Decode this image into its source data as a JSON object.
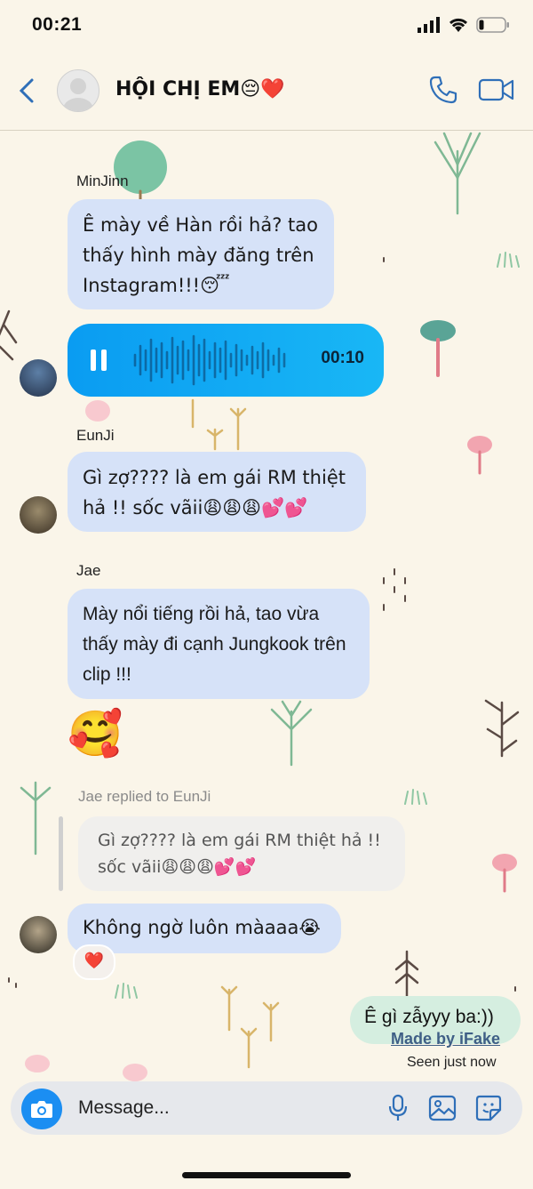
{
  "status_bar": {
    "time": "00:21"
  },
  "header": {
    "title": "HỘI CHỊ EM😔❤️"
  },
  "messages": [
    {
      "sender": "MinJinn",
      "text": "Ê mày về Hàn rồi hả? tao thấy hình mày đăng trên Instagram!!!😴"
    },
    {
      "voice_duration": "00:10"
    },
    {
      "sender": "EunJi",
      "text": "Gì zợ???? là em gái RM thiệt hả !! sốc vãii😩😩😩💕💕"
    },
    {
      "sender": "Jae",
      "text": "Mày nổi tiếng rồi hả, tao vừa thấy mày đi cạnh Jungkook trên clip !!!"
    },
    {
      "emoji": "🥰"
    },
    {
      "reply_label": "Jae replied to EunJi",
      "quoted": "Gì zợ???? là em gái RM thiệt hả !! sốc vãii😩😩😩💕💕",
      "text": "Không ngờ luôn màaaa😭",
      "reaction": "❤️"
    },
    {
      "text": "Ê gì zẫyyy ba:))",
      "mine": true
    }
  ],
  "watermark": "Made by iFake",
  "seen": "Seen just now",
  "composer": {
    "placeholder": "Message..."
  },
  "colors": {
    "incoming": "#d6e2f8",
    "outgoing": "#d5eee0",
    "voice": "#0a9cf2",
    "accent": "#1b8ef2"
  }
}
